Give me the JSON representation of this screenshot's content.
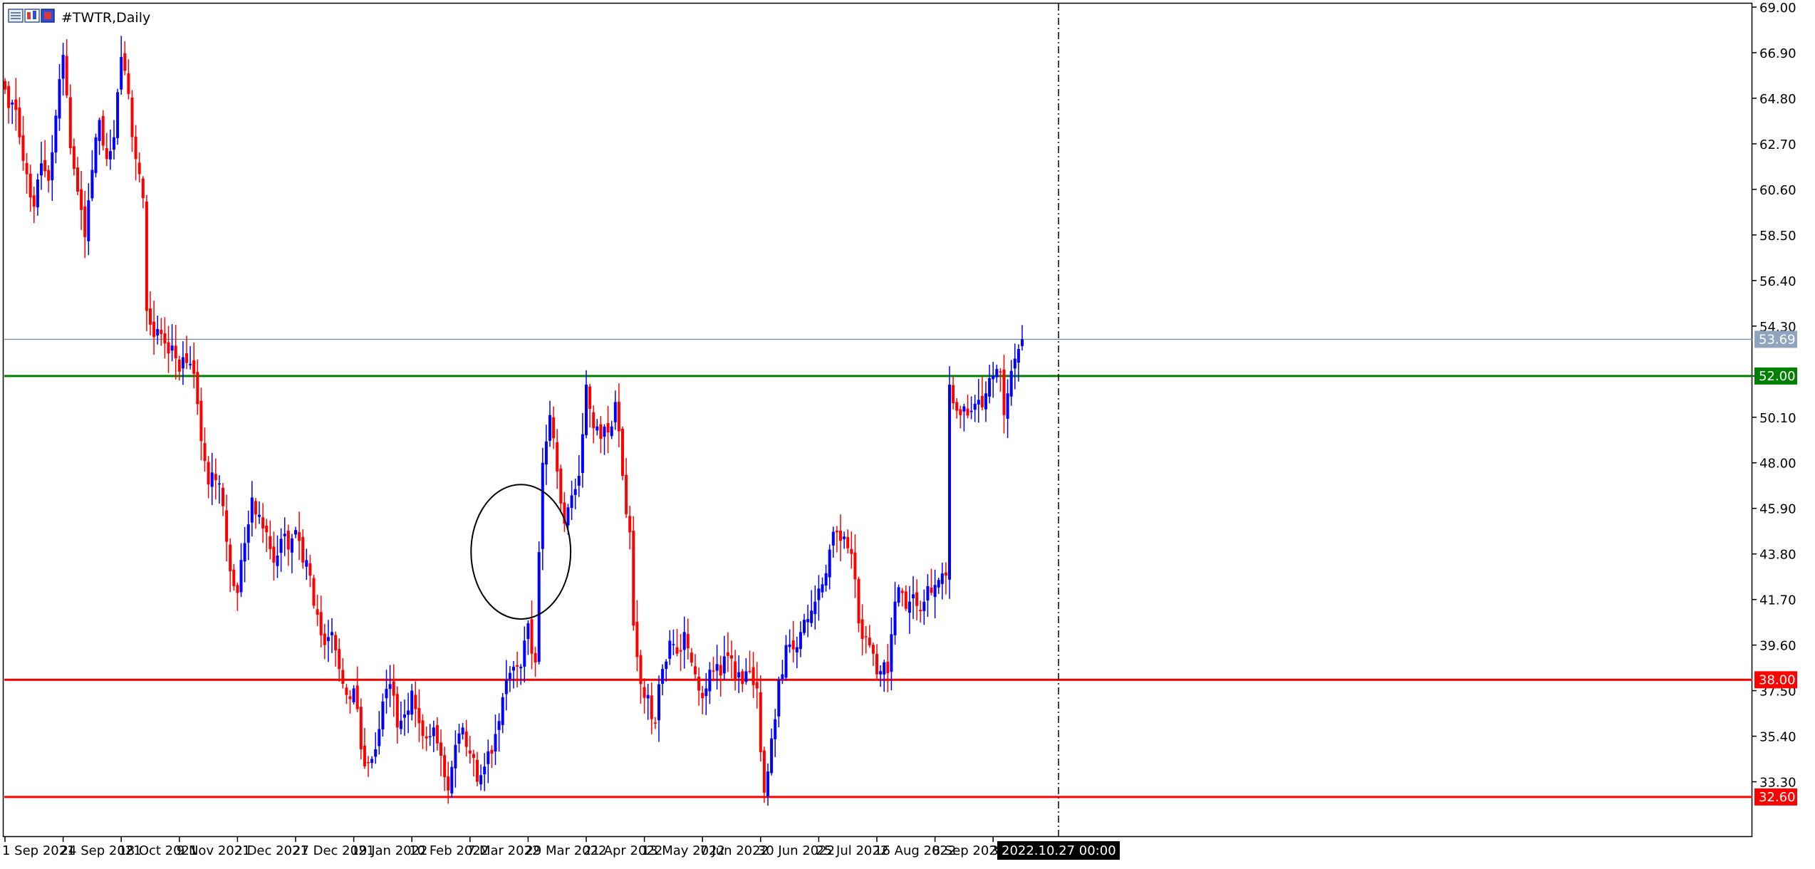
{
  "window": {
    "symbol_title": "#TWTR,Daily"
  },
  "colors": {
    "bull": "#0000ff",
    "bear": "#ff0000",
    "support_line": "#ff0000",
    "resistance_line": "#008000",
    "price_line": "#6b8aad",
    "period_separator": "#000000",
    "background": "#ffffff"
  },
  "icons": [
    "window-list-icon",
    "chart-grid-icon",
    "chart-mode-icon"
  ],
  "chart_data": {
    "type": "candlestick",
    "symbol": "#TWTR",
    "timeframe": "Daily",
    "ylim": [
      32.3,
      69.0
    ],
    "y_ticks": [
      "69.00",
      "66.90",
      "64.80",
      "62.70",
      "60.60",
      "58.50",
      "56.40",
      "54.30",
      "52.00",
      "50.10",
      "48.00",
      "45.90",
      "43.80",
      "41.70",
      "39.60",
      "37.50",
      "35.40",
      "33.30"
    ],
    "y_tick_values": [
      69.0,
      66.9,
      64.8,
      62.7,
      60.6,
      58.5,
      56.4,
      54.3,
      52.0,
      50.1,
      48.0,
      45.9,
      43.8,
      41.7,
      39.6,
      37.5,
      35.4,
      33.3
    ],
    "x_ticks": [
      {
        "label": "1 Sep 2021",
        "index": 0
      },
      {
        "label": "24 Sep 2021",
        "index": 16
      },
      {
        "label": "18 Oct 2021",
        "index": 32
      },
      {
        "label": "9 Nov 2021",
        "index": 48
      },
      {
        "label": "2 Dec 2021",
        "index": 64
      },
      {
        "label": "27 Dec 2021",
        "index": 80
      },
      {
        "label": "19 Jan 2022",
        "index": 96
      },
      {
        "label": "10 Feb 2022",
        "index": 112
      },
      {
        "label": "7 Mar 2022",
        "index": 128
      },
      {
        "label": "29 Mar 2022",
        "index": 144
      },
      {
        "label": "21 Apr 2022",
        "index": 160
      },
      {
        "label": "13 May 2022",
        "index": 176
      },
      {
        "label": "7 Jun 2022",
        "index": 192
      },
      {
        "label": "30 Jun 2022",
        "index": 208
      },
      {
        "label": "25 Jul 2022",
        "index": 224
      },
      {
        "label": "16 Aug 2022",
        "index": 240
      },
      {
        "label": "8 Sep 2022",
        "index": 256
      },
      {
        "label": "30 Sep 2",
        "index": 272
      }
    ],
    "horizontal_lines": [
      {
        "price": 52.0,
        "label": "52.00",
        "color": "#008000"
      },
      {
        "price": 38.0,
        "label": "38.00",
        "color": "#ff0000"
      },
      {
        "price": 32.6,
        "label": "32.60",
        "color": "#ff0000"
      }
    ],
    "current_price": {
      "price": 53.69,
      "label": "53.69"
    },
    "cursor": {
      "index": 290,
      "label": "2022.10.27 00:00"
    },
    "ellipse_annotation": {
      "center_index": 142,
      "center_price": 43.9,
      "radius_bars": 9,
      "radius_price": 3.1
    },
    "key_closes": [
      [
        0,
        65.2
      ],
      [
        2,
        64.6
      ],
      [
        4,
        63.0
      ],
      [
        6,
        61.3
      ],
      [
        8,
        59.8
      ],
      [
        10,
        61.8
      ],
      [
        12,
        61.0
      ],
      [
        14,
        64.0
      ],
      [
        16,
        66.8
      ],
      [
        18,
        62.5
      ],
      [
        20,
        60.5
      ],
      [
        22,
        58.4
      ],
      [
        24,
        61.5
      ],
      [
        26,
        63.8
      ],
      [
        28,
        62.0
      ],
      [
        30,
        63.0
      ],
      [
        32,
        66.7
      ],
      [
        34,
        65.0
      ],
      [
        36,
        62.0
      ],
      [
        38,
        60.2
      ],
      [
        39,
        55.0
      ],
      [
        41,
        53.8
      ],
      [
        44,
        53.5
      ],
      [
        46,
        53.4
      ],
      [
        48,
        52.2
      ],
      [
        50,
        52.6
      ],
      [
        52,
        52.1
      ],
      [
        54,
        49.0
      ],
      [
        56,
        47.0
      ],
      [
        58,
        47.2
      ],
      [
        60,
        46.0
      ],
      [
        62,
        43.0
      ],
      [
        64,
        42.0
      ],
      [
        66,
        44.3
      ],
      [
        68,
        46.4
      ],
      [
        70,
        45.6
      ],
      [
        72,
        44.8
      ],
      [
        74,
        43.4
      ],
      [
        76,
        44.5
      ],
      [
        78,
        44.0
      ],
      [
        80,
        44.9
      ],
      [
        82,
        43.4
      ],
      [
        84,
        42.8
      ],
      [
        86,
        41.0
      ],
      [
        88,
        39.6
      ],
      [
        90,
        40.2
      ],
      [
        92,
        38.5
      ],
      [
        94,
        37.3
      ],
      [
        96,
        37.6
      ],
      [
        98,
        34.8
      ],
      [
        100,
        34.2
      ],
      [
        102,
        34.8
      ],
      [
        104,
        37.0
      ],
      [
        106,
        37.8
      ],
      [
        108,
        35.8
      ],
      [
        110,
        36.4
      ],
      [
        112,
        37.5
      ],
      [
        114,
        36.0
      ],
      [
        116,
        35.3
      ],
      [
        118,
        35.8
      ],
      [
        120,
        34.5
      ],
      [
        122,
        32.9
      ],
      [
        124,
        35.0
      ],
      [
        126,
        35.8
      ],
      [
        128,
        34.6
      ],
      [
        130,
        33.3
      ],
      [
        132,
        34.0
      ],
      [
        134,
        34.6
      ],
      [
        136,
        36.1
      ],
      [
        138,
        38.0
      ],
      [
        140,
        38.6
      ],
      [
        142,
        38.6
      ],
      [
        144,
        40.6
      ],
      [
        145,
        39.2
      ],
      [
        146,
        38.8
      ],
      [
        148,
        48.0
      ],
      [
        150,
        50.2
      ],
      [
        152,
        47.6
      ],
      [
        154,
        45.2
      ],
      [
        156,
        46.5
      ],
      [
        158,
        47.4
      ],
      [
        160,
        51.6
      ],
      [
        162,
        49.6
      ],
      [
        164,
        49.1
      ],
      [
        166,
        49.4
      ],
      [
        168,
        50.8
      ],
      [
        170,
        47.4
      ],
      [
        172,
        44.8
      ],
      [
        173,
        40.5
      ],
      [
        175,
        37.8
      ],
      [
        177,
        37.3
      ],
      [
        179,
        36.0
      ],
      [
        181,
        38.5
      ],
      [
        183,
        39.8
      ],
      [
        185,
        39.2
      ],
      [
        187,
        40.2
      ],
      [
        189,
        38.8
      ],
      [
        191,
        37.5
      ],
      [
        193,
        37.6
      ],
      [
        195,
        38.4
      ],
      [
        197,
        38.2
      ],
      [
        199,
        39.1
      ],
      [
        201,
        38.0
      ],
      [
        203,
        37.8
      ],
      [
        205,
        38.4
      ],
      [
        207,
        37.6
      ],
      [
        209,
        32.8
      ],
      [
        211,
        35.3
      ],
      [
        213,
        38.0
      ],
      [
        215,
        39.6
      ],
      [
        217,
        39.4
      ],
      [
        219,
        40.2
      ],
      [
        221,
        40.8
      ],
      [
        223,
        41.6
      ],
      [
        225,
        42.4
      ],
      [
        227,
        44.0
      ],
      [
        229,
        44.8
      ],
      [
        231,
        44.6
      ],
      [
        233,
        43.8
      ],
      [
        235,
        40.6
      ],
      [
        237,
        40.0
      ],
      [
        239,
        39.2
      ],
      [
        241,
        38.4
      ],
      [
        243,
        38.3
      ],
      [
        245,
        41.6
      ],
      [
        247,
        42.0
      ],
      [
        249,
        41.6
      ],
      [
        251,
        41.4
      ],
      [
        253,
        41.6
      ],
      [
        255,
        42.0
      ],
      [
        257,
        42.6
      ],
      [
        259,
        42.8
      ],
      [
        260,
        51.6
      ],
      [
        262,
        50.4
      ],
      [
        264,
        50.6
      ],
      [
        266,
        50.4
      ],
      [
        268,
        50.9
      ],
      [
        270,
        51.2
      ],
      [
        272,
        52.0
      ],
      [
        274,
        52.2
      ],
      [
        275,
        50.2
      ],
      [
        276,
        51.2
      ],
      [
        278,
        52.8
      ],
      [
        280,
        53.69
      ]
    ]
  }
}
